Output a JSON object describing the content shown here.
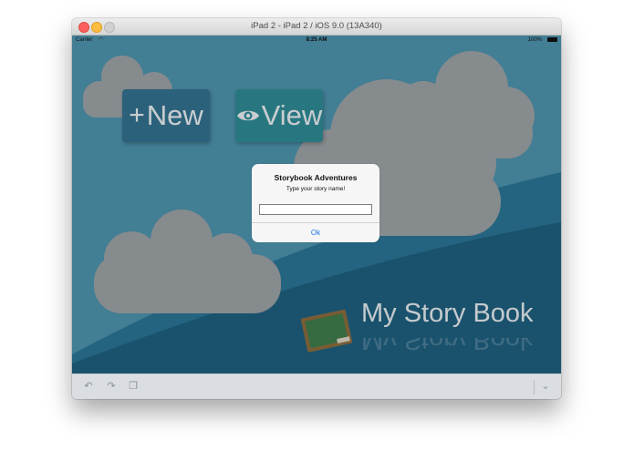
{
  "window": {
    "title": "iPad 2 - iPad 2 / iOS 9.0 (13A340)"
  },
  "status_bar": {
    "carrier": "Carrier",
    "time": "8:25 AM",
    "battery": "100%"
  },
  "buttons": {
    "new": {
      "icon": "plus-icon",
      "label": "New"
    },
    "view": {
      "icon": "eye-icon",
      "label": "View"
    }
  },
  "brand": {
    "title": "My Story Book",
    "icon": "chalkboard-icon"
  },
  "alert": {
    "title": "Storybook Adventures",
    "message": "Type your story name!",
    "input_value": "",
    "ok_label": "Ok"
  },
  "toolbar": {
    "icons": [
      "undo-icon",
      "redo-icon",
      "copy-icon",
      "chevron-down-icon"
    ]
  },
  "colors": {
    "sky": "#4a8ea8",
    "hill": "#1f6382",
    "cloud": "#9ea3a6",
    "new_tile": "#33708e",
    "view_tile": "#2f8994",
    "ok_text": "#1a74e8"
  }
}
